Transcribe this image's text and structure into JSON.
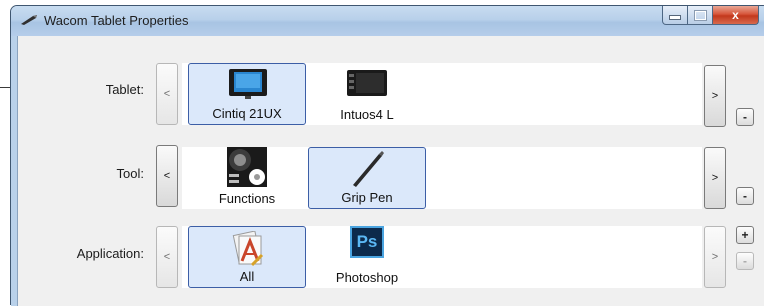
{
  "window": {
    "title": "Wacom Tablet Properties"
  },
  "window_controls": {
    "minimize": "–",
    "maximize": "□",
    "close": "x"
  },
  "rows": {
    "tablet": {
      "label": "Tablet:",
      "prev": "<",
      "next": ">",
      "remove": "-",
      "items": [
        {
          "label": "Cintiq 21UX",
          "selected": true
        },
        {
          "label": "Intuos4 L",
          "selected": false
        }
      ]
    },
    "tool": {
      "label": "Tool:",
      "prev": "<",
      "next": ">",
      "remove": "-",
      "items": [
        {
          "label": "Functions",
          "selected": false
        },
        {
          "label": "Grip Pen",
          "selected": true
        }
      ]
    },
    "application": {
      "label": "Application:",
      "prev": "<",
      "next": ">",
      "add": "+",
      "remove": "-",
      "items": [
        {
          "label": "All",
          "selected": true,
          "icon": "application-all-icon"
        },
        {
          "label": "Photoshop",
          "selected": false,
          "icon": "photoshop-icon",
          "icon_text": "Ps"
        }
      ]
    }
  },
  "colors": {
    "selection_fill": "#dbe8fa",
    "selection_border": "#3c5ea6",
    "close_button": "#c2381c"
  }
}
